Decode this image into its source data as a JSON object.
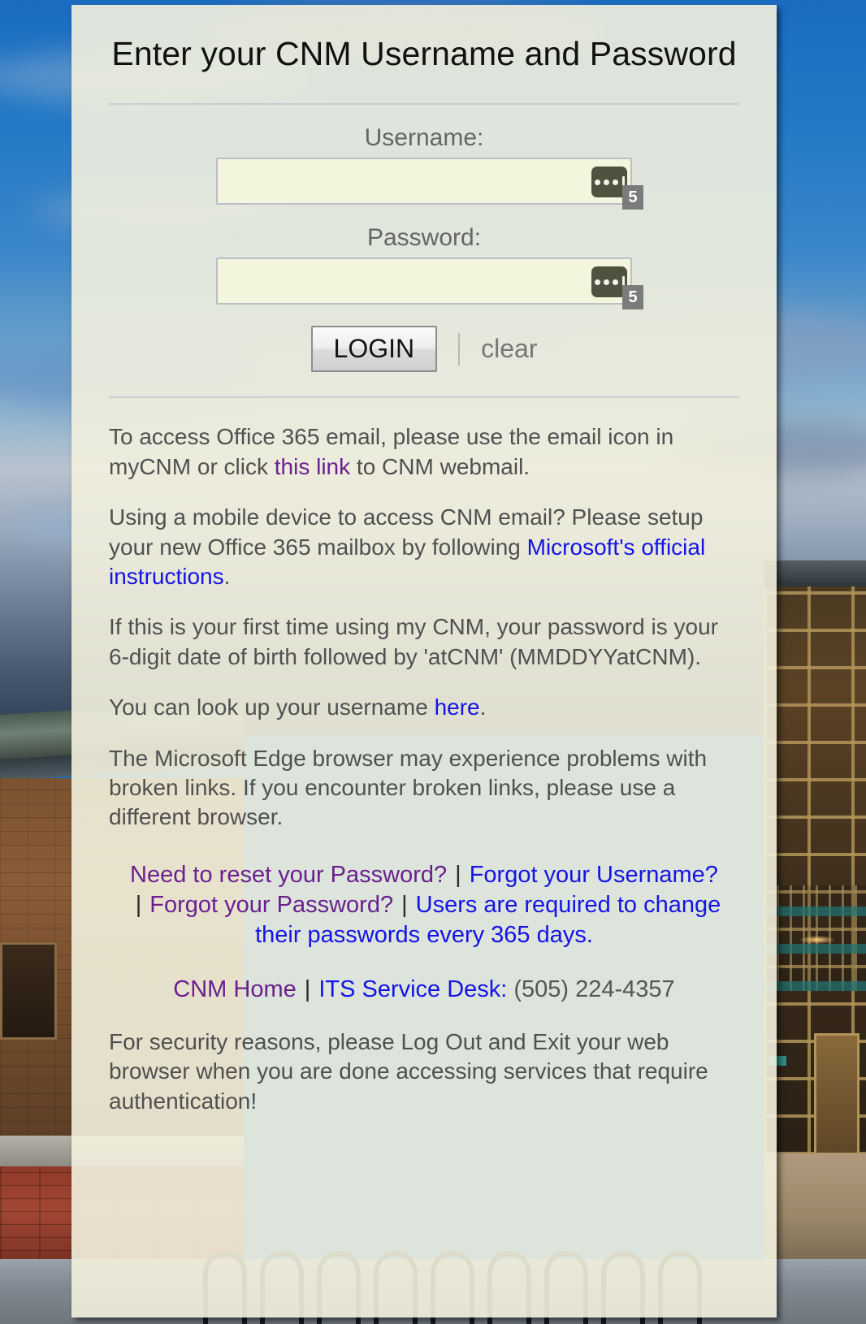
{
  "page": {
    "title": "Enter your CNM Username and Password"
  },
  "form": {
    "username_label": "Username:",
    "username_value": "",
    "username_placeholder": "",
    "password_label": "Password:",
    "password_value": "",
    "password_placeholder": "",
    "login_button": "LOGIN",
    "clear_link": "clear",
    "separator": "|",
    "password_manager_badge": "5",
    "password_manager_icon": "lastpass-dots-icon"
  },
  "info": {
    "p1_a": "To access Office 365 email, please use the email icon in myCNM or click ",
    "p1_link": "this link",
    "p1_b": " to CNM webmail.",
    "p2_a": "Using a mobile device to access CNM email? Please setup your new Office 365 mailbox by following ",
    "p2_link": "Microsoft's official instructions",
    "p2_b": ".",
    "p3": "If this is your first time using my CNM, your password is your 6-digit date of birth followed by 'atCNM' (MMDDYYatCNM).",
    "p4_a": "You can look up your username ",
    "p4_link": "here",
    "p4_b": ".",
    "p5": "The Microsoft Edge browser may experience problems with broken links. If you encounter broken links, please use a different browser."
  },
  "links": {
    "reset_password": "Need to reset your Password?",
    "forgot_username": "Forgot your Username?",
    "forgot_password": "Forgot your Password?",
    "change_policy": "Users are required to change their passwords every 365 days.",
    "separator": "|"
  },
  "contact": {
    "cnm_home": "CNM Home",
    "separator": "|",
    "service_desk": "ITS Service Desk:",
    "phone": "(505) 224-4357"
  },
  "footer": {
    "note": "For security reasons, please Log Out and Exit your web browser when you are done accessing services that require authentication!"
  },
  "colors": {
    "link_blue": "#1414e6",
    "link_purple": "#6a2090",
    "card_bg": "#f3f1de",
    "text_gray": "#505050"
  }
}
